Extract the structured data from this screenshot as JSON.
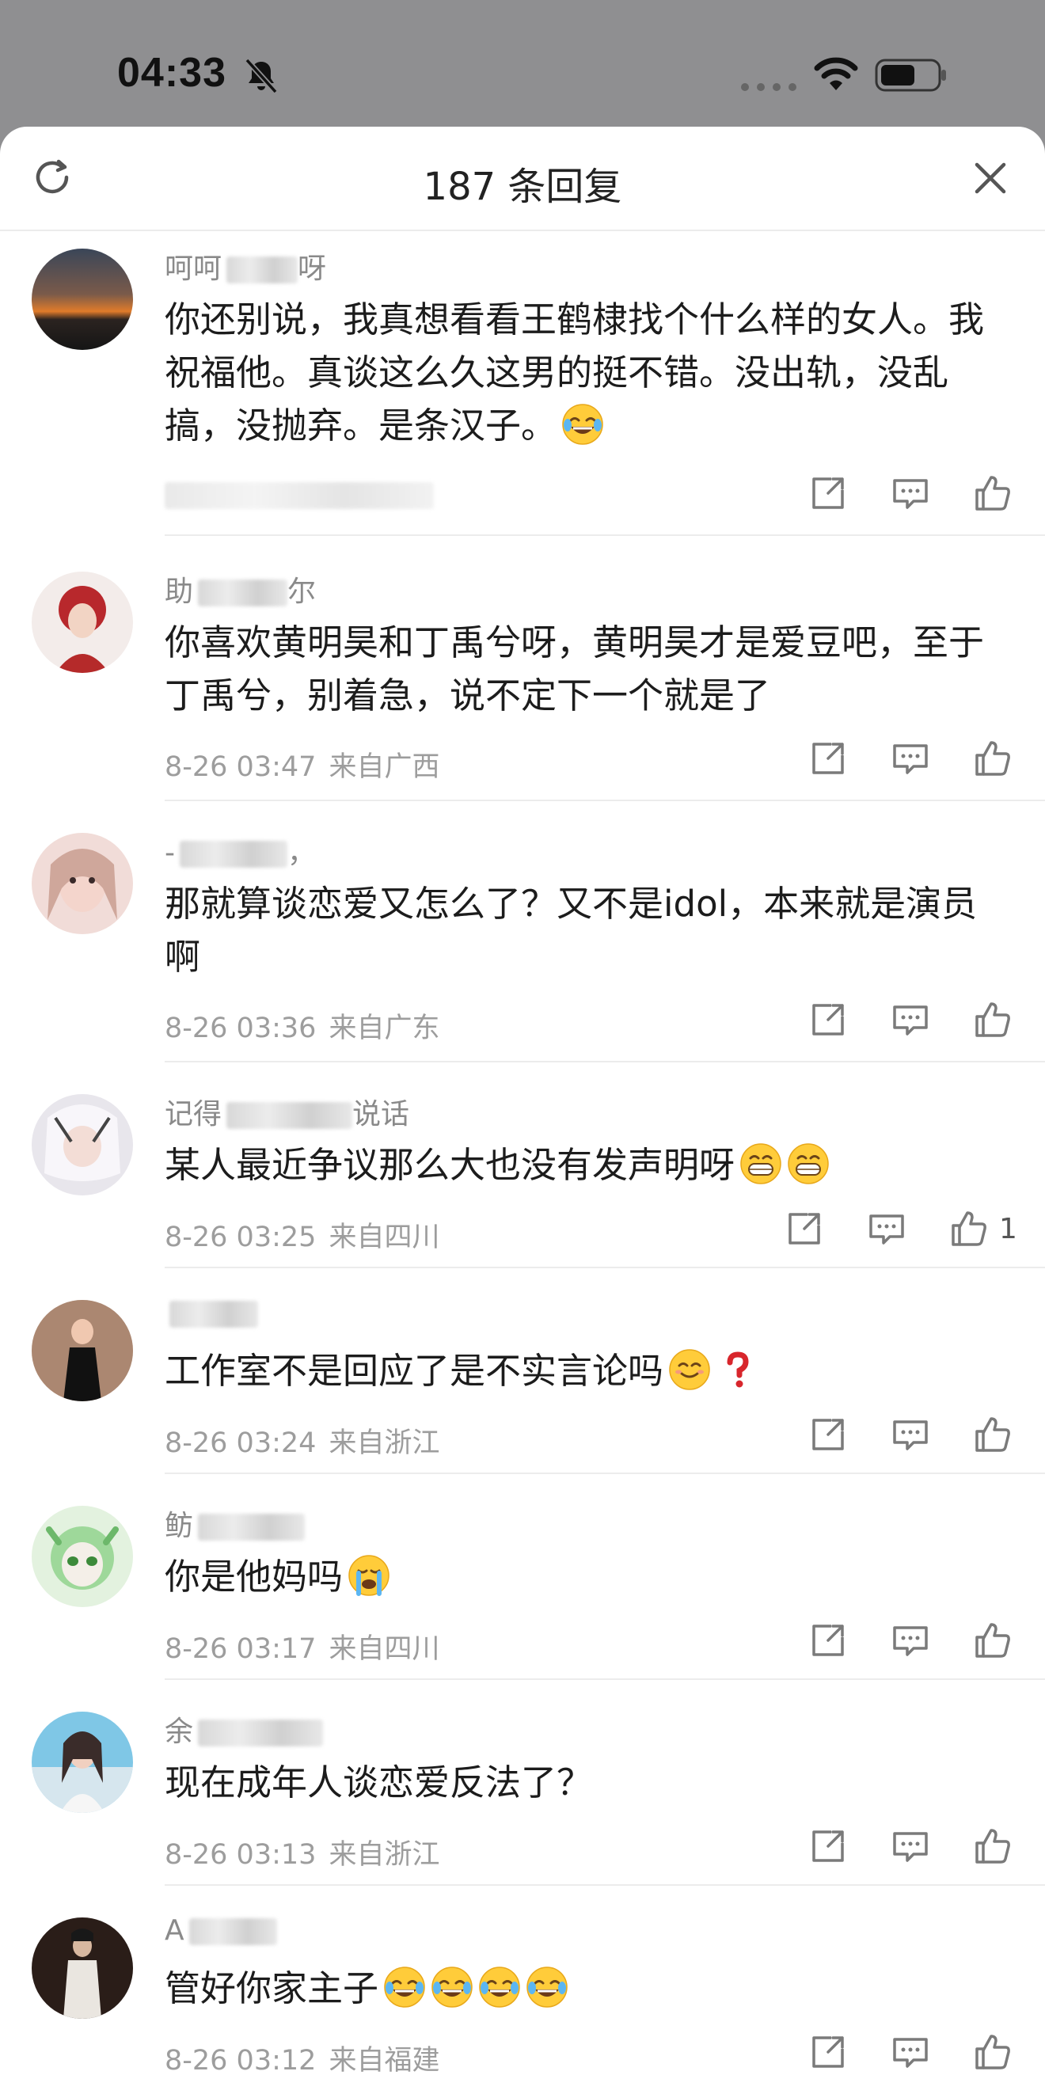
{
  "status_bar": {
    "time": "04:33",
    "icons": [
      "bell-slash-icon",
      "signal-dots-icon",
      "wifi-icon",
      "battery-icon"
    ]
  },
  "sheet": {
    "title": "187 条回复",
    "icons": [
      "refresh-icon",
      "close-icon"
    ]
  },
  "colors": {
    "background_dim": "#8f8f91",
    "sheet": "#ffffff",
    "meta_text": "#9d9d9d",
    "divider": "#ececec"
  },
  "comments": [
    {
      "username": "呵呵",
      "username_tail": "呀",
      "text": "你还别说，我真想看看王鹤棣找个什么样的女人。我祝福他。真谈这么久这男的挺不错。没出轨，没乱搞，没抛弃。是条汉子。",
      "emojis": [
        "laughing-tears-emoji"
      ],
      "time": "",
      "location": "",
      "likes": ""
    },
    {
      "username": "助",
      "username_tail": "尔",
      "text": "你喜欢黄明昊和丁禹兮呀，黄明昊才是爱豆吧，至于丁禹兮，别着急，说不定下一个就是了",
      "emojis": [],
      "time": "8-26 03:47",
      "location": "来自广西",
      "likes": ""
    },
    {
      "username": "-",
      "username_tail": "，",
      "text": "那就算谈恋爱又怎么了？又不是idol，本来就是演员啊",
      "emojis": [],
      "time": "8-26 03:36",
      "location": "来自广东",
      "likes": ""
    },
    {
      "username": "记得",
      "username_tail": "说话",
      "text": "某人最近争议那么大也没有发声明呀",
      "emojis": [
        "grin-emoji",
        "grin-emoji"
      ],
      "time": "8-26 03:25",
      "location": "来自四川",
      "likes": "1"
    },
    {
      "username": "",
      "username_tail": "",
      "text": "工作室不是回应了是不实言论吗",
      "emojis": [
        "smile-emoji",
        "red-question-emoji"
      ],
      "time": "8-26 03:24",
      "location": "来自浙江",
      "likes": ""
    },
    {
      "username": "鲂",
      "username_tail": "",
      "text": "你是他妈吗",
      "emojis": [
        "crying-emoji"
      ],
      "time": "8-26 03:17",
      "location": "来自四川",
      "likes": ""
    },
    {
      "username": "余",
      "username_tail": "",
      "text": "现在成年人谈恋爱反法了？",
      "emojis": [],
      "time": "8-26 03:13",
      "location": "来自浙江",
      "likes": ""
    },
    {
      "username": "A",
      "username_tail": "",
      "text": "管好你家主子",
      "emojis": [
        "laughing-tears-emoji",
        "laughing-tears-emoji",
        "laughing-tears-emoji",
        "laughing-tears-emoji"
      ],
      "time": "8-26 03:12",
      "location": "来自福建",
      "likes": ""
    }
  ],
  "action_icons": [
    "share-icon",
    "comment-icon",
    "like-icon"
  ]
}
